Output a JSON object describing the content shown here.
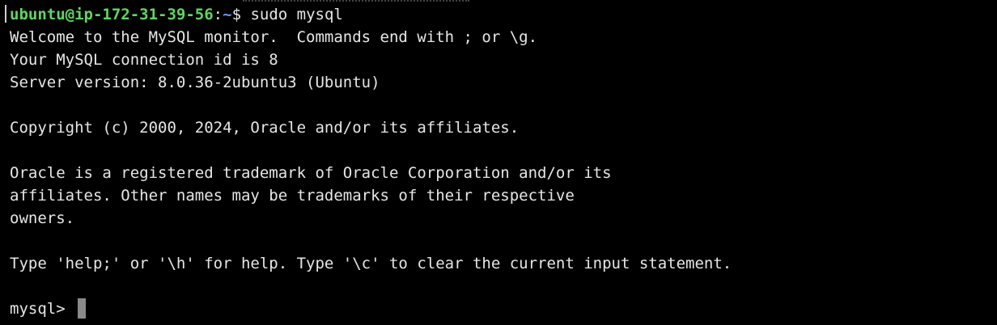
{
  "terminal": {
    "prompt": {
      "user_host": "ubuntu@ip-172-31-39-56",
      "separator": ":",
      "path": "~",
      "symbol": "$ ",
      "command": "sudo mysql"
    },
    "output": [
      "Welcome to the MySQL monitor.  Commands end with ; or \\g.",
      "Your MySQL connection id is 8",
      "Server version: 8.0.36-2ubuntu3 (Ubuntu)",
      "",
      "Copyright (c) 2000, 2024, Oracle and/or its affiliates.",
      "",
      "Oracle is a registered trademark of Oracle Corporation and/or its",
      "affiliates. Other names may be trademarks of their respective",
      "owners.",
      "",
      "Type 'help;' or '\\h' for help. Type '\\c' to clear the current input statement.",
      ""
    ],
    "mysql_prompt": "mysql> "
  },
  "colors": {
    "background": "#000000",
    "text": "#e6e6e6",
    "user_host": "#5fd75f",
    "path": "#6f8fff",
    "cursor": "#8a8a8a"
  }
}
